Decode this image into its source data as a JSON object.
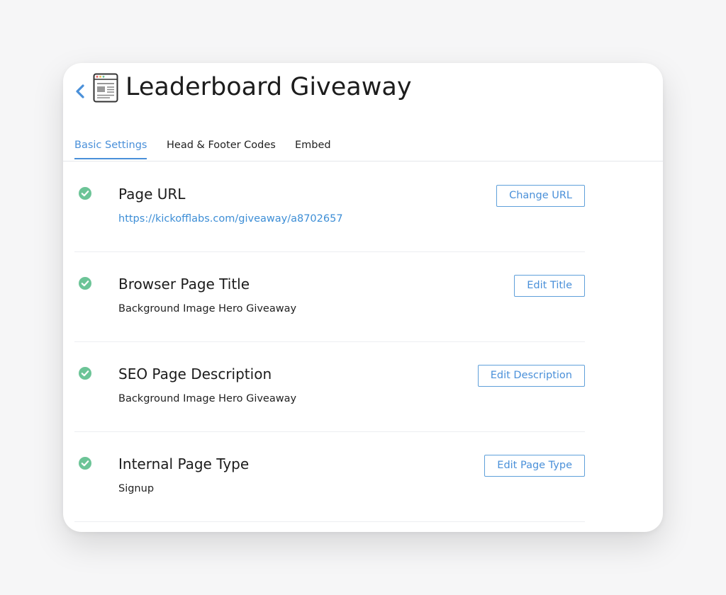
{
  "header": {
    "title": "Leaderboard Giveaway",
    "back_icon": "chevron-left-icon",
    "page_icon": "webpage-icon"
  },
  "tabs": [
    {
      "label": "Basic Settings",
      "active": true
    },
    {
      "label": "Head & Footer Codes",
      "active": false
    },
    {
      "label": "Embed",
      "active": false
    }
  ],
  "settings": [
    {
      "title": "Page URL",
      "value": "https://kickofflabs.com/giveaway/a8702657",
      "button": "Change URL",
      "status": "check-icon"
    },
    {
      "title": "Browser Page Title",
      "value": "Background Image Hero Giveaway",
      "button": "Edit Title",
      "status": "check-icon"
    },
    {
      "title": "SEO Page Description",
      "value": "Background Image Hero Giveaway",
      "button": "Edit Description",
      "status": "check-icon"
    },
    {
      "title": "Internal Page Type",
      "value": "Signup",
      "button": "Edit Page Type",
      "status": "check-icon"
    }
  ],
  "colors": {
    "accent": "#4a90d9",
    "success": "#6cc497",
    "text": "#1c1c1c"
  }
}
